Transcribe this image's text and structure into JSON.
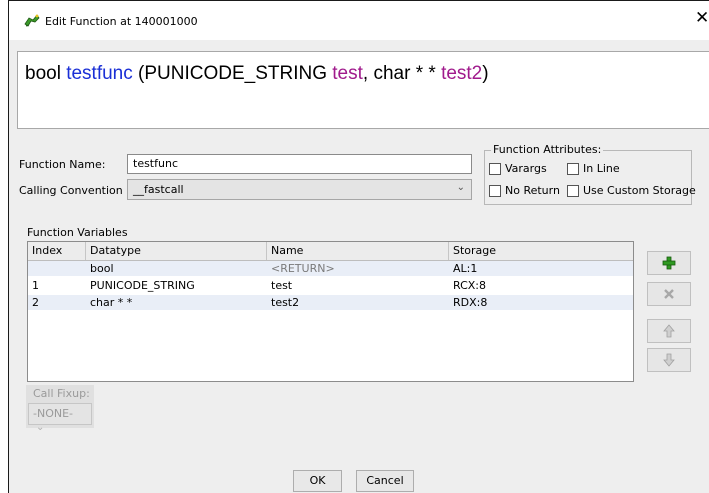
{
  "window": {
    "title": "Edit Function at 140001000",
    "close_glyph": "✕",
    "icon": "function-dragon-icon"
  },
  "signature": {
    "return_type": "bool",
    "name": "testfunc",
    "open": "(",
    "param1_type": "PUNICODE_STRING",
    "param1_name": "test",
    "comma": ",",
    "param2_type": "char * *",
    "param2_name": "test2",
    "close": ")",
    "name_color": "#1a2fd6",
    "param_color": "#a01a8c"
  },
  "form": {
    "function_name_label": "Function Name:",
    "function_name_value": "testfunc",
    "calling_convention_label": "Calling Convention",
    "calling_convention_value": "__fastcall"
  },
  "attributes": {
    "legend": "Function Attributes:",
    "varargs": "Varargs",
    "inline": "In Line",
    "no_return": "No Return",
    "custom_storage": "Use Custom Storage"
  },
  "variables": {
    "section_label": "Function Variables",
    "headers": [
      "Index",
      "Datatype",
      "Name",
      "Storage"
    ],
    "rows": [
      {
        "index": "",
        "datatype": "bool",
        "name": "<RETURN>",
        "storage": "AL:1"
      },
      {
        "index": "1",
        "datatype": "PUNICODE_STRING",
        "name": "test",
        "storage": "RCX:8"
      },
      {
        "index": "2",
        "datatype": "char * *",
        "name": "test2",
        "storage": "RDX:8"
      }
    ]
  },
  "side_buttons": {
    "add_icon": "plus-icon",
    "remove_icon": "x-icon",
    "up_icon": "arrow-up-icon",
    "down_icon": "arrow-down-icon"
  },
  "call_fixup": {
    "label": "Call Fixup:",
    "value": "-NONE-"
  },
  "buttons": {
    "ok": "OK",
    "cancel": "Cancel"
  }
}
